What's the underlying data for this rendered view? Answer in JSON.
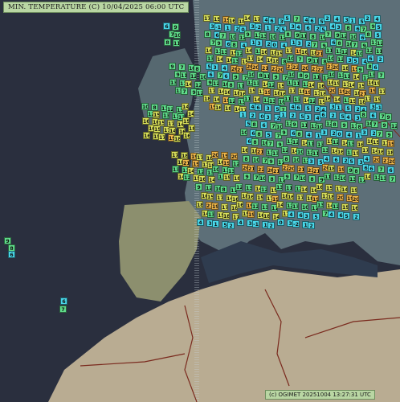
{
  "map": {
    "title": "MIN. TEMPERATURE (C)  10/04/2025 06:00 UTC",
    "credit": "(c) OGIMET 20251004 13:27:31 UTC",
    "colors": {
      "ocean": "#2a2f3e",
      "land_north": "#5d6f78",
      "land_south": "#b9ac92",
      "cold": "#48d6e8",
      "mild": "#5fdc8a",
      "warm": "#d9e05a",
      "hot": "#f2b84a",
      "border": "#7a2a1e"
    },
    "stations": [
      {
        "t": "9"
      },
      {
        "t": "8"
      },
      {
        "t": "6"
      },
      {
        "t": "6"
      },
      {
        "t": "7"
      },
      {
        "t": "6"
      },
      {
        "t": "9"
      },
      {
        "t": "7"
      },
      {
        "t": "10"
      },
      {
        "t": "8"
      },
      {
        "t": "11"
      },
      {
        "t": "9"
      },
      {
        "t": "7"
      },
      {
        "t": "10"
      },
      {
        "t": "8"
      },
      {
        "t": "9"
      },
      {
        "t": "11"
      },
      {
        "t": "12"
      },
      {
        "t": "10"
      },
      {
        "t": "13"
      },
      {
        "t": "11"
      },
      {
        "t": "14"
      },
      {
        "t": "12"
      },
      {
        "t": "13"
      },
      {
        "t": "7"
      },
      {
        "t": "9"
      },
      {
        "t": "12"
      },
      {
        "t": "10"
      },
      {
        "t": "8"
      },
      {
        "t": "11"
      },
      {
        "t": "12"
      },
      {
        "t": "13"
      },
      {
        "t": "14"
      },
      {
        "t": "12"
      },
      {
        "t": "15"
      },
      {
        "t": "13"
      },
      {
        "t": "11"
      },
      {
        "t": "12"
      },
      {
        "t": "14"
      },
      {
        "t": "16"
      },
      {
        "t": "16"
      },
      {
        "t": "15"
      },
      {
        "t": "17"
      },
      {
        "t": "14"
      },
      {
        "t": "15"
      },
      {
        "t": "16"
      },
      {
        "t": "15"
      },
      {
        "t": "17"
      },
      {
        "t": "14"
      },
      {
        "t": "16"
      },
      {
        "t": "18"
      },
      {
        "t": "16"
      },
      {
        "t": "15"
      },
      {
        "t": "17"
      },
      {
        "t": "19"
      },
      {
        "t": "18"
      },
      {
        "t": "16"
      },
      {
        "t": "17"
      },
      {
        "t": "18"
      },
      {
        "t": "19"
      },
      {
        "t": "17"
      },
      {
        "t": "18"
      },
      {
        "t": "20"
      },
      {
        "t": "19"
      },
      {
        "t": "20"
      },
      {
        "t": "18"
      },
      {
        "t": "21"
      },
      {
        "t": "19"
      },
      {
        "t": "17"
      },
      {
        "t": "18"
      },
      {
        "t": "16"
      },
      {
        "t": "19"
      },
      {
        "t": "12"
      },
      {
        "t": "13"
      },
      {
        "t": "11"
      },
      {
        "t": "14"
      },
      {
        "t": "12"
      },
      {
        "t": "13"
      },
      {
        "t": "10"
      },
      {
        "t": "11"
      },
      {
        "t": "13"
      },
      {
        "t": "14"
      },
      {
        "t": "12"
      },
      {
        "t": "15"
      },
      {
        "t": "16"
      },
      {
        "t": "14"
      },
      {
        "t": "13"
      },
      {
        "t": "15"
      },
      {
        "t": "18"
      },
      {
        "t": "17"
      },
      {
        "t": "15"
      },
      {
        "t": "19"
      },
      {
        "t": "16"
      },
      {
        "t": "18"
      },
      {
        "t": "14"
      },
      {
        "t": "17"
      },
      {
        "t": "4"
      },
      {
        "t": "6"
      },
      {
        "t": "3"
      },
      {
        "t": "5"
      },
      {
        "t": "7"
      },
      {
        "t": "4"
      },
      {
        "t": "6"
      },
      {
        "t": "5"
      },
      {
        "t": "2"
      },
      {
        "t": "4"
      },
      {
        "t": "3"
      },
      {
        "t": "1"
      },
      {
        "t": "5"
      },
      {
        "t": "2"
      },
      {
        "t": "4"
      },
      {
        "t": "3"
      },
      {
        "t": "-1"
      },
      {
        "t": "1"
      },
      {
        "t": "2"
      },
      {
        "t": "0"
      },
      {
        "t": "3"
      },
      {
        "t": "-2"
      },
      {
        "t": "1"
      },
      {
        "t": "2"
      },
      {
        "t": "5"
      },
      {
        "t": "3"
      },
      {
        "t": "4"
      },
      {
        "t": "6"
      },
      {
        "t": "2"
      },
      {
        "t": "5"
      },
      {
        "t": "4"
      },
      {
        "t": "3"
      },
      {
        "t": "8"
      },
      {
        "t": "6"
      },
      {
        "t": "7"
      },
      {
        "t": "9"
      },
      {
        "t": "5"
      },
      {
        "t": "8"
      },
      {
        "t": "6"
      },
      {
        "t": "7"
      },
      {
        "t": "10"
      },
      {
        "t": "12"
      },
      {
        "t": "9"
      },
      {
        "t": "11"
      },
      {
        "t": "13"
      },
      {
        "t": "10"
      },
      {
        "t": "12"
      },
      {
        "t": "8"
      },
      {
        "t": "9"
      },
      {
        "t": "11"
      },
      {
        "t": "8"
      },
      {
        "t": "10"
      },
      {
        "t": "7"
      },
      {
        "t": "9"
      },
      {
        "t": "12"
      },
      {
        "t": "10"
      },
      {
        "t": "6"
      },
      {
        "t": "8"
      },
      {
        "t": "5"
      },
      {
        "t": "7"
      },
      {
        "t": "9"
      },
      {
        "t": "6"
      },
      {
        "t": "8"
      },
      {
        "t": "4"
      },
      {
        "t": "1"
      },
      {
        "t": "3"
      },
      {
        "t": "2"
      },
      {
        "t": "0"
      },
      {
        "t": "4"
      },
      {
        "t": "1"
      },
      {
        "t": "3"
      },
      {
        "t": "2"
      },
      {
        "t": "7"
      },
      {
        "t": "9"
      },
      {
        "t": "6"
      },
      {
        "t": "8"
      },
      {
        "t": "10"
      },
      {
        "t": "7"
      },
      {
        "t": "9"
      },
      {
        "t": "11"
      },
      {
        "t": "12"
      },
      {
        "t": "14"
      },
      {
        "t": "11"
      },
      {
        "t": "13"
      },
      {
        "t": "15"
      },
      {
        "t": "12"
      },
      {
        "t": "14"
      },
      {
        "t": "13"
      },
      {
        "t": "16"
      },
      {
        "t": "18"
      },
      {
        "t": "15"
      },
      {
        "t": "17"
      },
      {
        "t": "19"
      },
      {
        "t": "16"
      },
      {
        "t": "18"
      },
      {
        "t": "21"
      },
      {
        "t": "11"
      },
      {
        "t": "13"
      },
      {
        "t": "12"
      },
      {
        "t": "14"
      },
      {
        "t": "10"
      },
      {
        "t": "12"
      },
      {
        "t": "11"
      },
      {
        "t": "13"
      },
      {
        "t": "14"
      },
      {
        "t": "16"
      },
      {
        "t": "13"
      },
      {
        "t": "15"
      },
      {
        "t": "17"
      },
      {
        "t": "14"
      },
      {
        "t": "16"
      },
      {
        "t": "18"
      },
      {
        "t": "8"
      },
      {
        "t": "10"
      },
      {
        "t": "7"
      },
      {
        "t": "9"
      },
      {
        "t": "11"
      },
      {
        "t": "8"
      },
      {
        "t": "10"
      },
      {
        "t": "12"
      },
      {
        "t": "3"
      },
      {
        "t": "5"
      },
      {
        "t": "4"
      },
      {
        "t": "6"
      },
      {
        "t": "2"
      },
      {
        "t": "5"
      },
      {
        "t": "3"
      },
      {
        "t": "4"
      },
      {
        "t": "20"
      },
      {
        "t": "21"
      },
      {
        "t": "20"
      },
      {
        "t": "20"
      },
      {
        "t": "21"
      },
      {
        "t": "22"
      },
      {
        "t": "20"
      },
      {
        "t": "21"
      },
      {
        "t": "22"
      },
      {
        "t": "20"
      },
      {
        "t": "21"
      },
      {
        "t": "22"
      },
      {
        "t": "21"
      },
      {
        "t": "20"
      },
      {
        "t": "18"
      },
      {
        "t": "19"
      }
    ]
  }
}
